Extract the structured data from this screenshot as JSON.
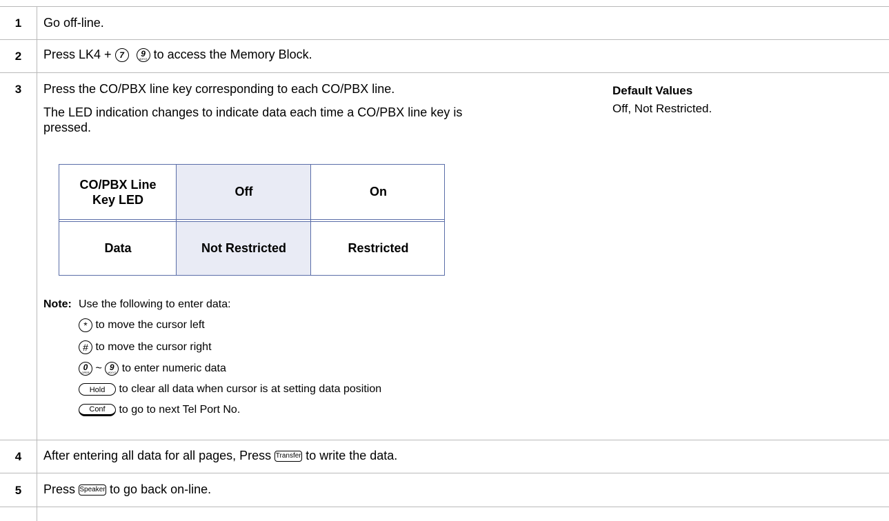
{
  "steps": [
    {
      "num": "1",
      "text": "Go off-line."
    },
    {
      "num": "2",
      "text_before": "Press LK4 + ",
      "text_after": " to access the Memory Block.",
      "keys": [
        "7",
        "9"
      ]
    },
    {
      "num": "3",
      "line1": "Press the CO/PBX line key corresponding to each CO/PBX line.",
      "line2": "The LED indication changes to indicate data each time a CO/PBX line key is",
      "line3": "pressed.",
      "default_title": "Default Values",
      "default_value": "Off, Not Restricted.",
      "table": {
        "header": [
          "CO/PBX Line Key LED",
          "Off",
          "On"
        ],
        "row": [
          "Data",
          "Not Restricted",
          "Restricted"
        ]
      },
      "note_label": "Note:",
      "note_intro": "Use the following to enter data:",
      "note_items": [
        {
          "key": "*",
          "text": "to move the cursor left"
        },
        {
          "key": "#",
          "text": "to move the cursor right"
        },
        {
          "key_from": "0",
          "key_from_sub": "OPER",
          "tilde": "~",
          "key_to": "9",
          "key_to_sub": "WXYZ",
          "text": "to enter numeric data"
        },
        {
          "key": "Hold",
          "text": "to clear all data when cursor is at setting data position"
        },
        {
          "key": "Conf",
          "text": "to go to next Tel Port No."
        }
      ]
    },
    {
      "num": "4",
      "text_before": "After entering all data for all pages, Press ",
      "key": "Transfer",
      "text_after": " to write the data."
    },
    {
      "num": "5",
      "text_before": "Press ",
      "key": "Speaker",
      "text_after": " to go back on-line."
    }
  ],
  "key_subs": {
    "9": "WXYZ"
  }
}
